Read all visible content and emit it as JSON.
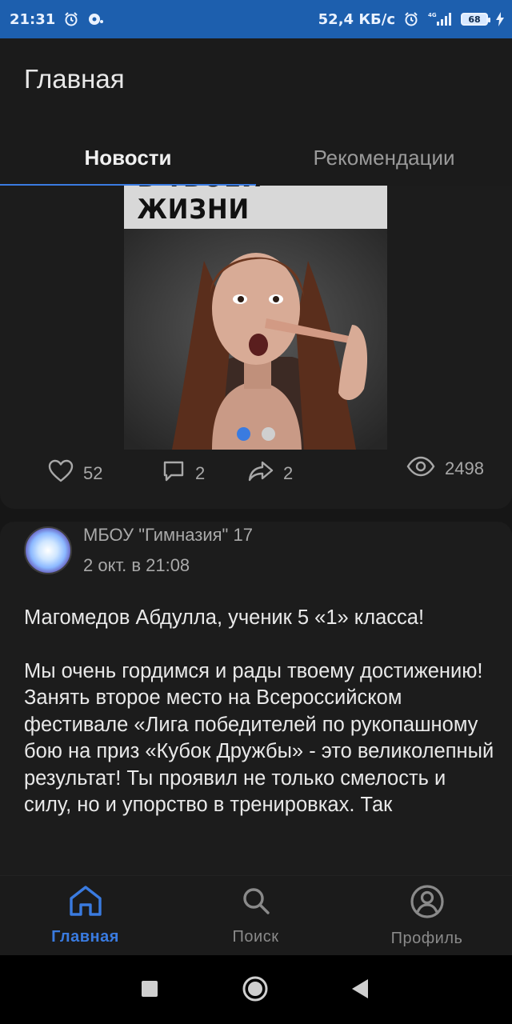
{
  "status_bar": {
    "time": "21:31",
    "net_speed": "52,4 КБ/с",
    "signal": "4G",
    "battery": "68"
  },
  "app": {
    "title": "Главная",
    "tabs": [
      {
        "label": "Новости",
        "active": true
      },
      {
        "label": "Рекомендации",
        "active": false
      }
    ]
  },
  "post1": {
    "image_caption": "В ТВОЕЙ ЖИЗНИ",
    "carousel": {
      "count": 2,
      "active_index": 0
    },
    "likes": "52",
    "comments": "2",
    "shares": "2",
    "views": "2498"
  },
  "post2": {
    "author": "МБОУ \"Гимназия\" 17",
    "date": "2 окт. в 21:08",
    "paragraph1": "Магомедов Абдулла, ученик 5 «1» класса!",
    "paragraph2": "Мы очень гордимся и рады твоему достижению! Занять второе место на Всероссийском фестивале «Лига победителей по рукопашному бою на приз «Кубок Дружбы» - это великолепный результат! Ты проявил не только смелость и силу, но и упорство в тренировках. Так"
  },
  "bottom_nav": {
    "items": [
      {
        "label": "Главная",
        "icon": "home-icon",
        "active": true
      },
      {
        "label": "Поиск",
        "icon": "search-icon",
        "active": false
      },
      {
        "label": "Профиль",
        "icon": "profile-icon",
        "active": false
      }
    ]
  },
  "colors": {
    "accent": "#3a7be0",
    "status_bar": "#1d5fae",
    "background": "#161616"
  }
}
